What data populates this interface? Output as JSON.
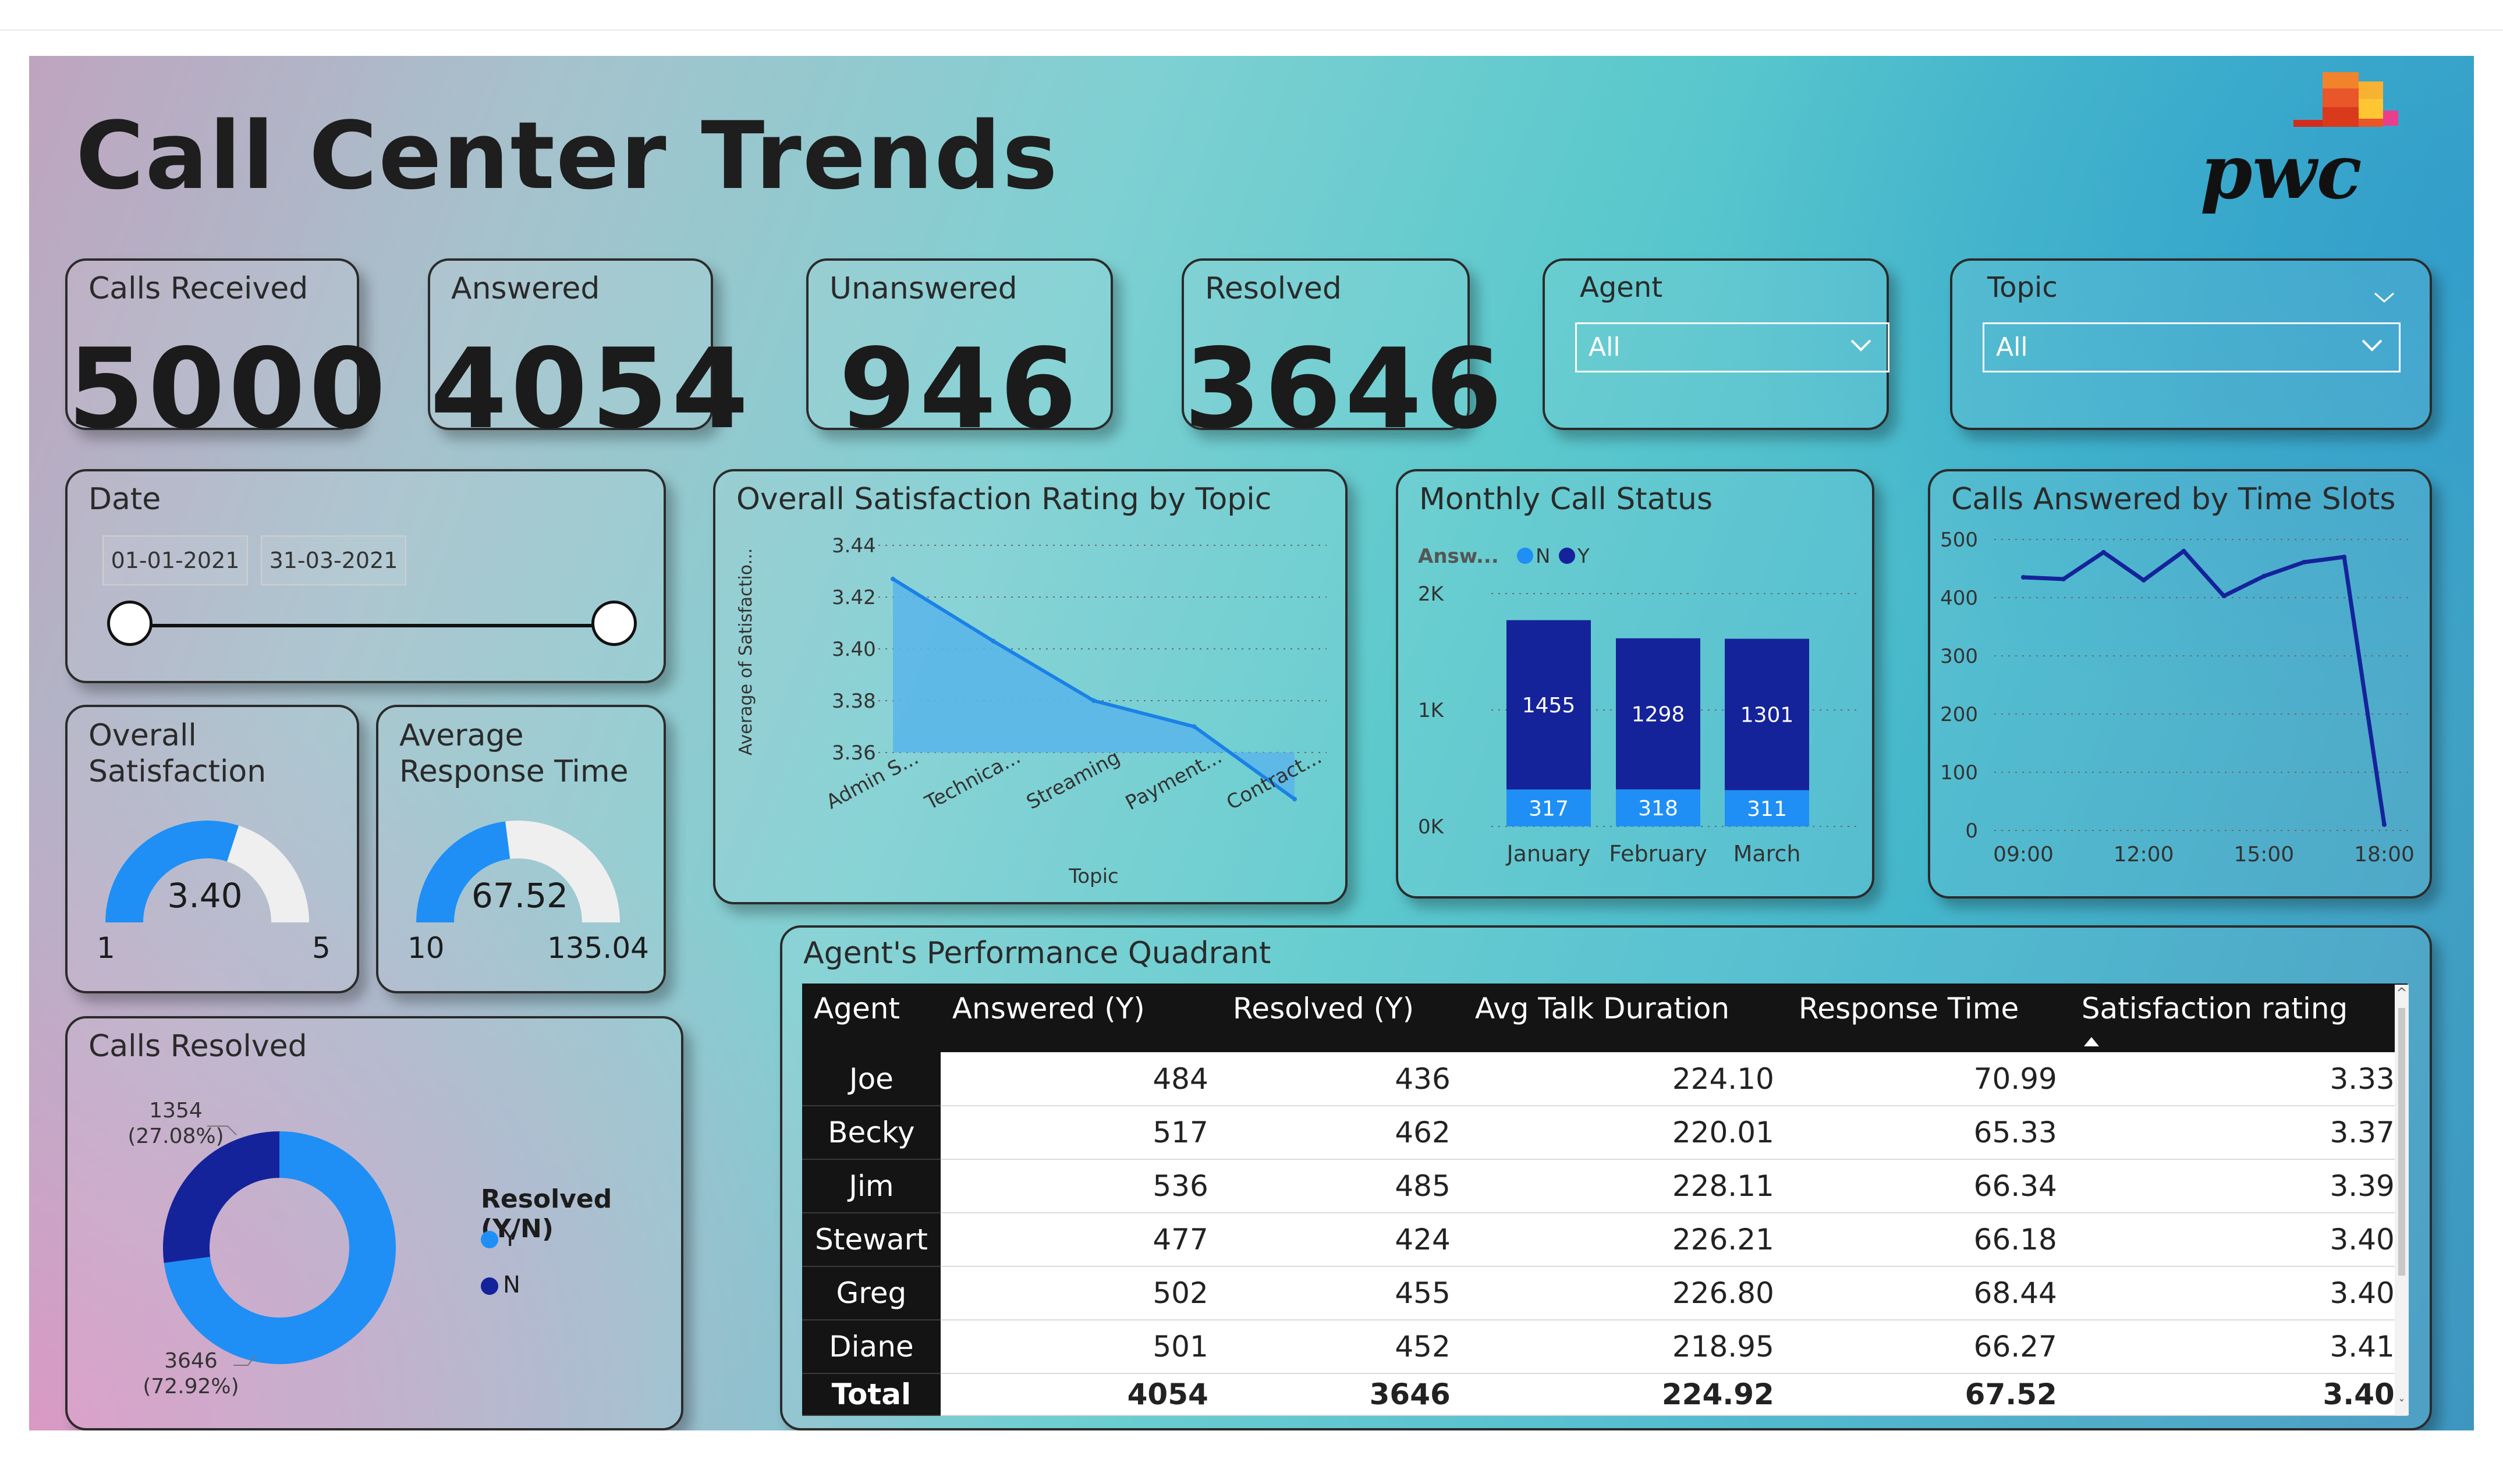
{
  "title": "Call Center Trends",
  "logo": {
    "text": "pwc"
  },
  "kpis": {
    "calls_received": {
      "label": "Calls Received",
      "value": "5000"
    },
    "answered": {
      "label": "Answered",
      "value": "4054"
    },
    "unanswered": {
      "label": "Unanswered",
      "value": "946"
    },
    "resolved": {
      "label": "Resolved",
      "value": "3646"
    }
  },
  "filters": {
    "agent": {
      "label": "Agent",
      "value": "All"
    },
    "topic": {
      "label": "Topic",
      "value": "All"
    }
  },
  "date": {
    "label": "Date",
    "start": "01-01-2021",
    "end": "31-03-2021"
  },
  "gauges": {
    "satisfaction": {
      "label_line1": "Overall",
      "label_line2": "Satisfaction",
      "value": "3.40",
      "min": "1",
      "max": "5",
      "value_num": 3.4,
      "min_num": 1,
      "max_num": 5
    },
    "response": {
      "label_line1": "Average",
      "label_line2": "Response Time",
      "value": "67.52",
      "min": "10",
      "max": "135.04",
      "value_num": 67.52,
      "min_num": 10,
      "max_num": 135.04
    }
  },
  "colors": {
    "light_blue": "#1f8ff5",
    "dark_blue": "#15239a",
    "area_fill": "#5bb6e8",
    "line": "#1a82e6",
    "gauge_track": "#efefef",
    "time_line": "#15239a"
  },
  "chart_data": [
    {
      "id": "satisfaction_by_topic",
      "type": "area",
      "title": "Overall Satisfaction Rating by Topic",
      "xlabel": "Topic",
      "ylabel": "Average of Satisfactio...",
      "categories": [
        "Admin S...",
        "Technica...",
        "Streaming",
        "Payment...",
        "Contract..."
      ],
      "values": [
        3.427,
        3.403,
        3.38,
        3.37,
        3.342
      ],
      "yticks": [
        "3.44",
        "3.42",
        "3.40",
        "3.38",
        "3.36"
      ],
      "ylim": [
        3.36,
        3.44
      ],
      "grid": true
    },
    {
      "id": "monthly_call_status",
      "type": "bar",
      "stacked": true,
      "title": "Monthly Call Status",
      "legend_title": "Answ...",
      "categories": [
        "January",
        "February",
        "March"
      ],
      "series": [
        {
          "name": "N",
          "values": [
            317,
            318,
            311
          ],
          "labels": [
            "317",
            "318",
            "311"
          ]
        },
        {
          "name": "Y",
          "values": [
            1455,
            1298,
            1301
          ],
          "labels": [
            "1455",
            "1298",
            "1301"
          ]
        }
      ],
      "yticks": [
        "2K",
        "1K",
        "0K"
      ],
      "ylim": [
        0,
        2000
      ],
      "legend_position": "top-left"
    },
    {
      "id": "calls_by_time_slots",
      "type": "line",
      "title": "Calls Answered by Time Slots",
      "x_ticks": [
        "09:00",
        "12:00",
        "15:00",
        "18:00"
      ],
      "x": [
        9,
        10,
        11,
        12,
        13,
        14,
        15,
        16,
        17,
        18
      ],
      "values": [
        435,
        432,
        478,
        430,
        480,
        403,
        437,
        461,
        470,
        10
      ],
      "yticks": [
        "500",
        "400",
        "300",
        "200",
        "100",
        "0"
      ],
      "ylim": [
        0,
        500
      ],
      "grid": true
    },
    {
      "id": "calls_resolved",
      "type": "pie",
      "donut": true,
      "title": "Calls Resolved",
      "legend_title": "Resolved (Y/N)",
      "slices": [
        {
          "name": "Y",
          "value": 3646,
          "label": "3646",
          "pct": "(72.92%)"
        },
        {
          "name": "N",
          "value": 1354,
          "label": "1354",
          "pct": "(27.08%)"
        }
      ]
    },
    {
      "id": "agent_performance",
      "type": "table",
      "title": "Agent's Performance Quadrant",
      "columns": [
        "Agent",
        "Answered (Y)",
        "Resolved (Y)",
        "Avg Talk Duration",
        "Response Time",
        "Satisfaction rating"
      ],
      "rows": [
        [
          "Joe",
          "484",
          "436",
          "224.10",
          "70.99",
          "3.33"
        ],
        [
          "Becky",
          "517",
          "462",
          "220.01",
          "65.33",
          "3.37"
        ],
        [
          "Jim",
          "536",
          "485",
          "228.11",
          "66.34",
          "3.39"
        ],
        [
          "Stewart",
          "477",
          "424",
          "226.21",
          "66.18",
          "3.40"
        ],
        [
          "Greg",
          "502",
          "455",
          "226.80",
          "68.44",
          "3.40"
        ],
        [
          "Diane",
          "501",
          "452",
          "218.95",
          "66.27",
          "3.41"
        ]
      ],
      "total": [
        "Total",
        "4054",
        "3646",
        "224.92",
        "67.52",
        "3.40"
      ]
    }
  ]
}
